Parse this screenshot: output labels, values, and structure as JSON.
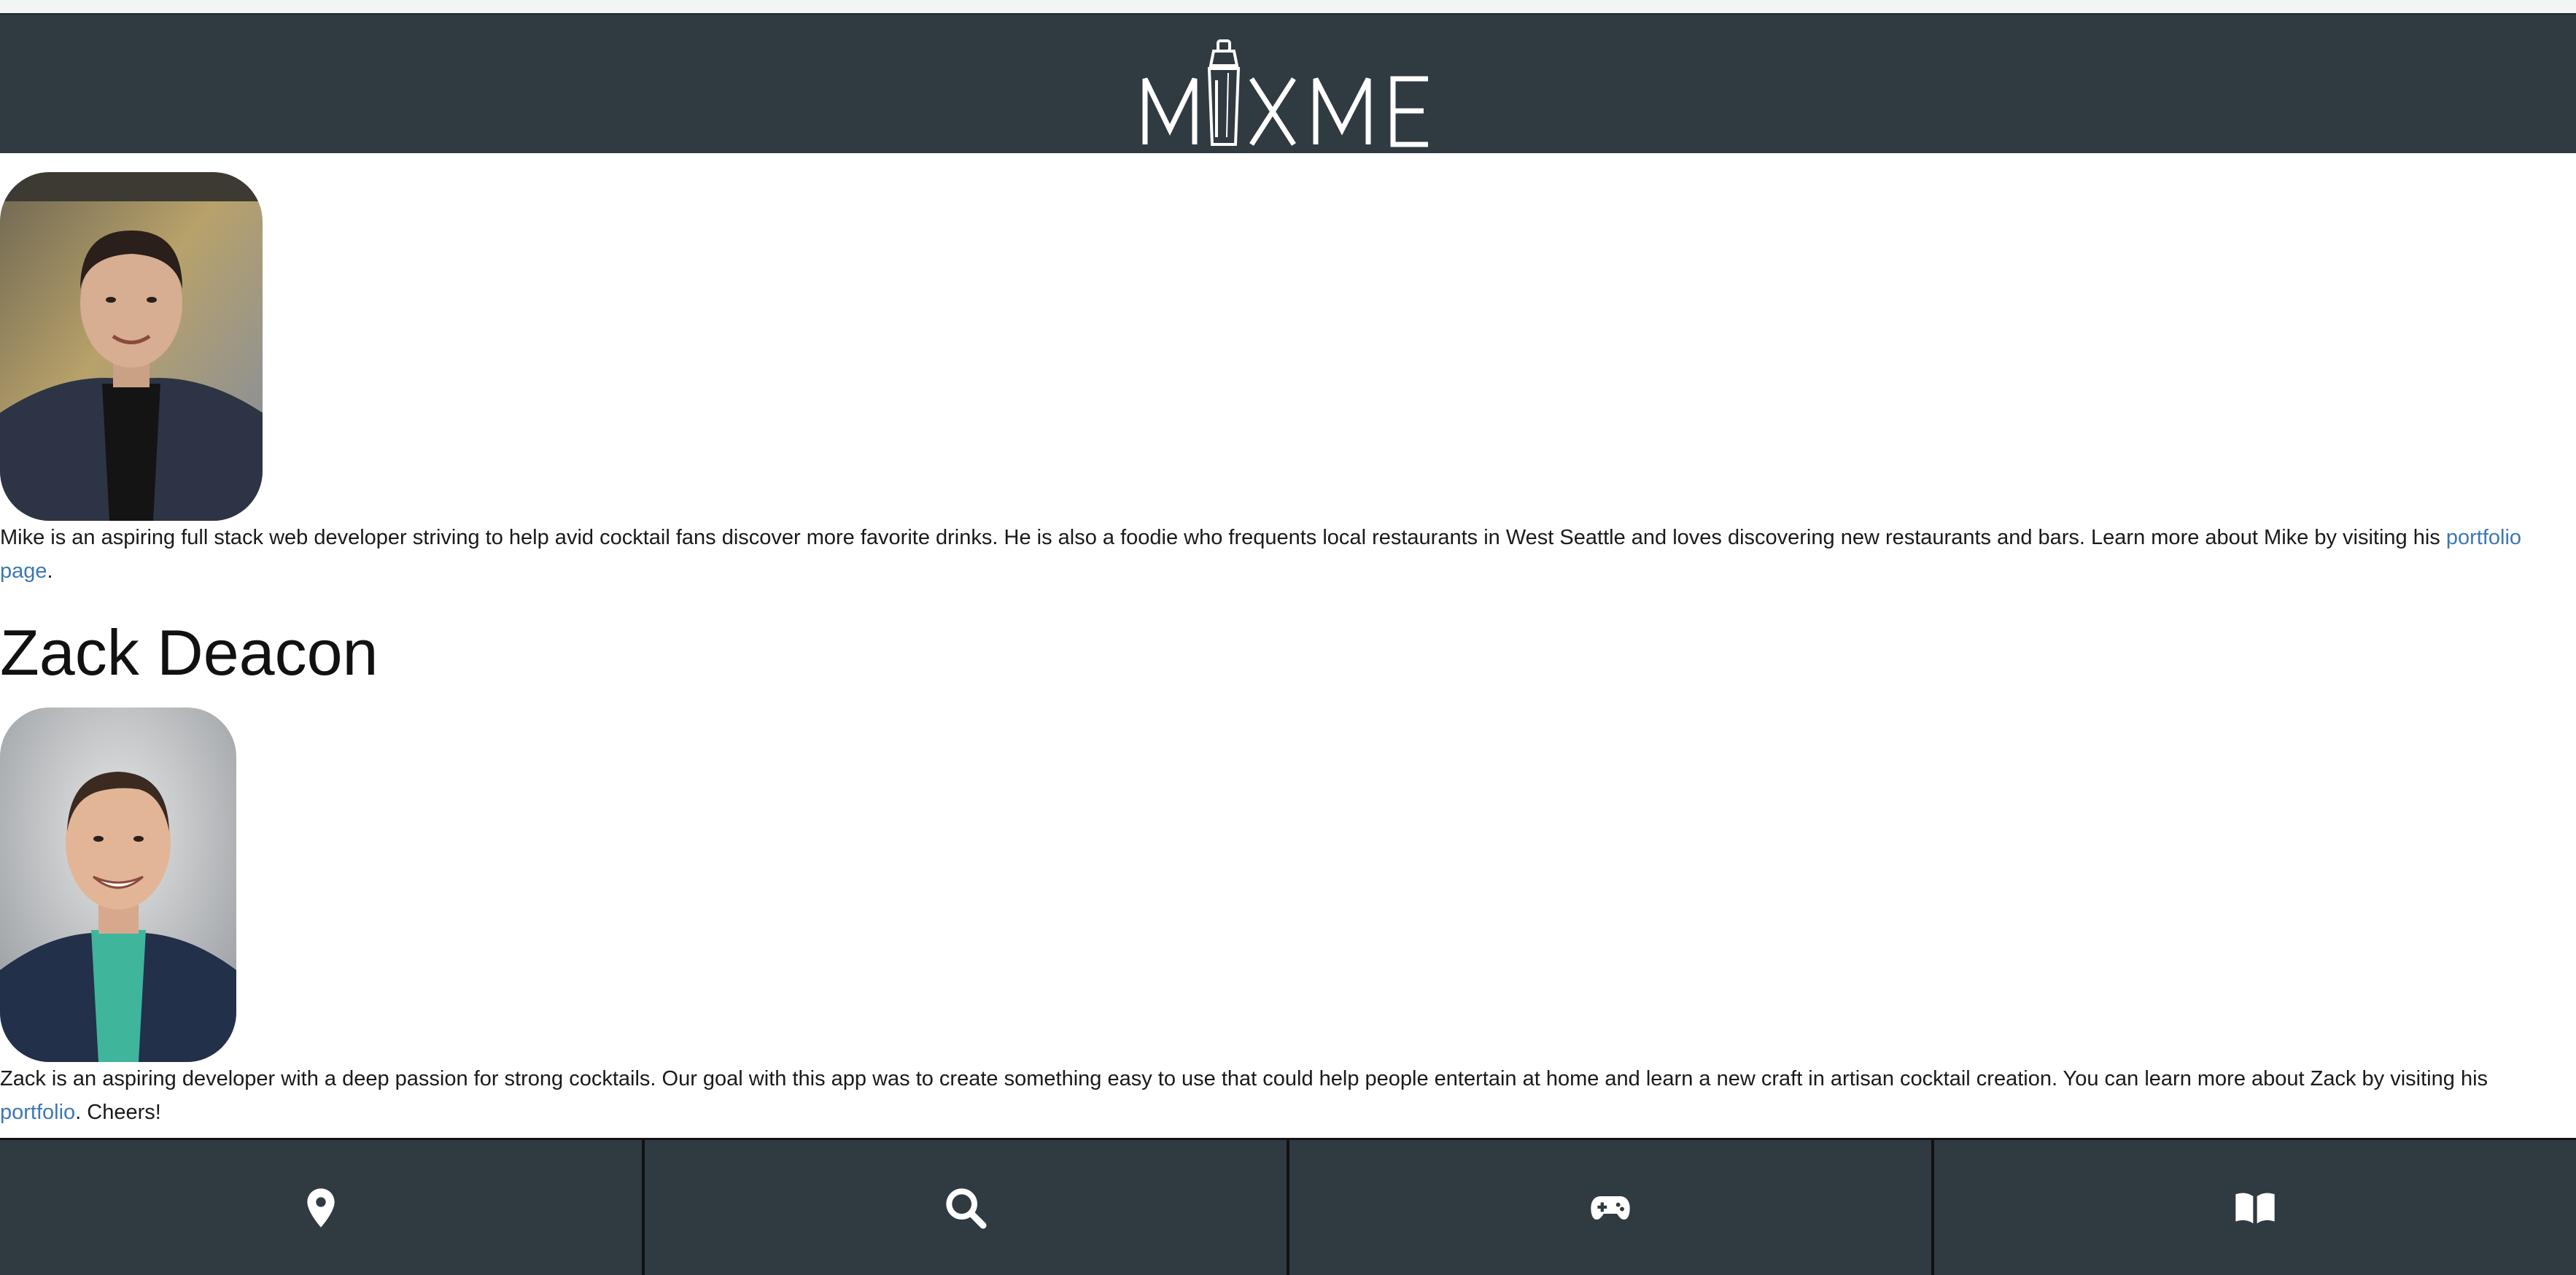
{
  "header": {
    "logo_text": "MIX ME"
  },
  "people": [
    {
      "name": "",
      "photo_icon": "mike-portrait",
      "bio_text": "Mike is an aspiring full stack web developer striving to help avid cocktail fans discover more favorite drinks. He is also a foodie who frequents local restaurants in West Seattle and loves discovering new restaurants and bars. Learn more about Mike by visiting his ",
      "link_text": "portfolio page",
      "bio_suffix": "."
    },
    {
      "name": "Zack Deacon",
      "photo_icon": "zack-portrait",
      "bio_text": "Zack is an aspiring developer with a deep passion for strong cocktails. Our goal with this app was to create something easy to use that could help people entertain at home and learn a new craft in artisan cocktail creation. You can learn more about Zack by visiting his ",
      "link_text": "portfolio",
      "bio_suffix": ". Cheers!"
    }
  ],
  "bottom_nav": [
    {
      "icon": "map-pin-icon"
    },
    {
      "icon": "search-icon"
    },
    {
      "icon": "gamepad-icon"
    },
    {
      "icon": "book-icon"
    }
  ],
  "colors": {
    "header_bg": "#2f3a41",
    "link": "#3d78b5",
    "text": "#1a1a1a"
  }
}
